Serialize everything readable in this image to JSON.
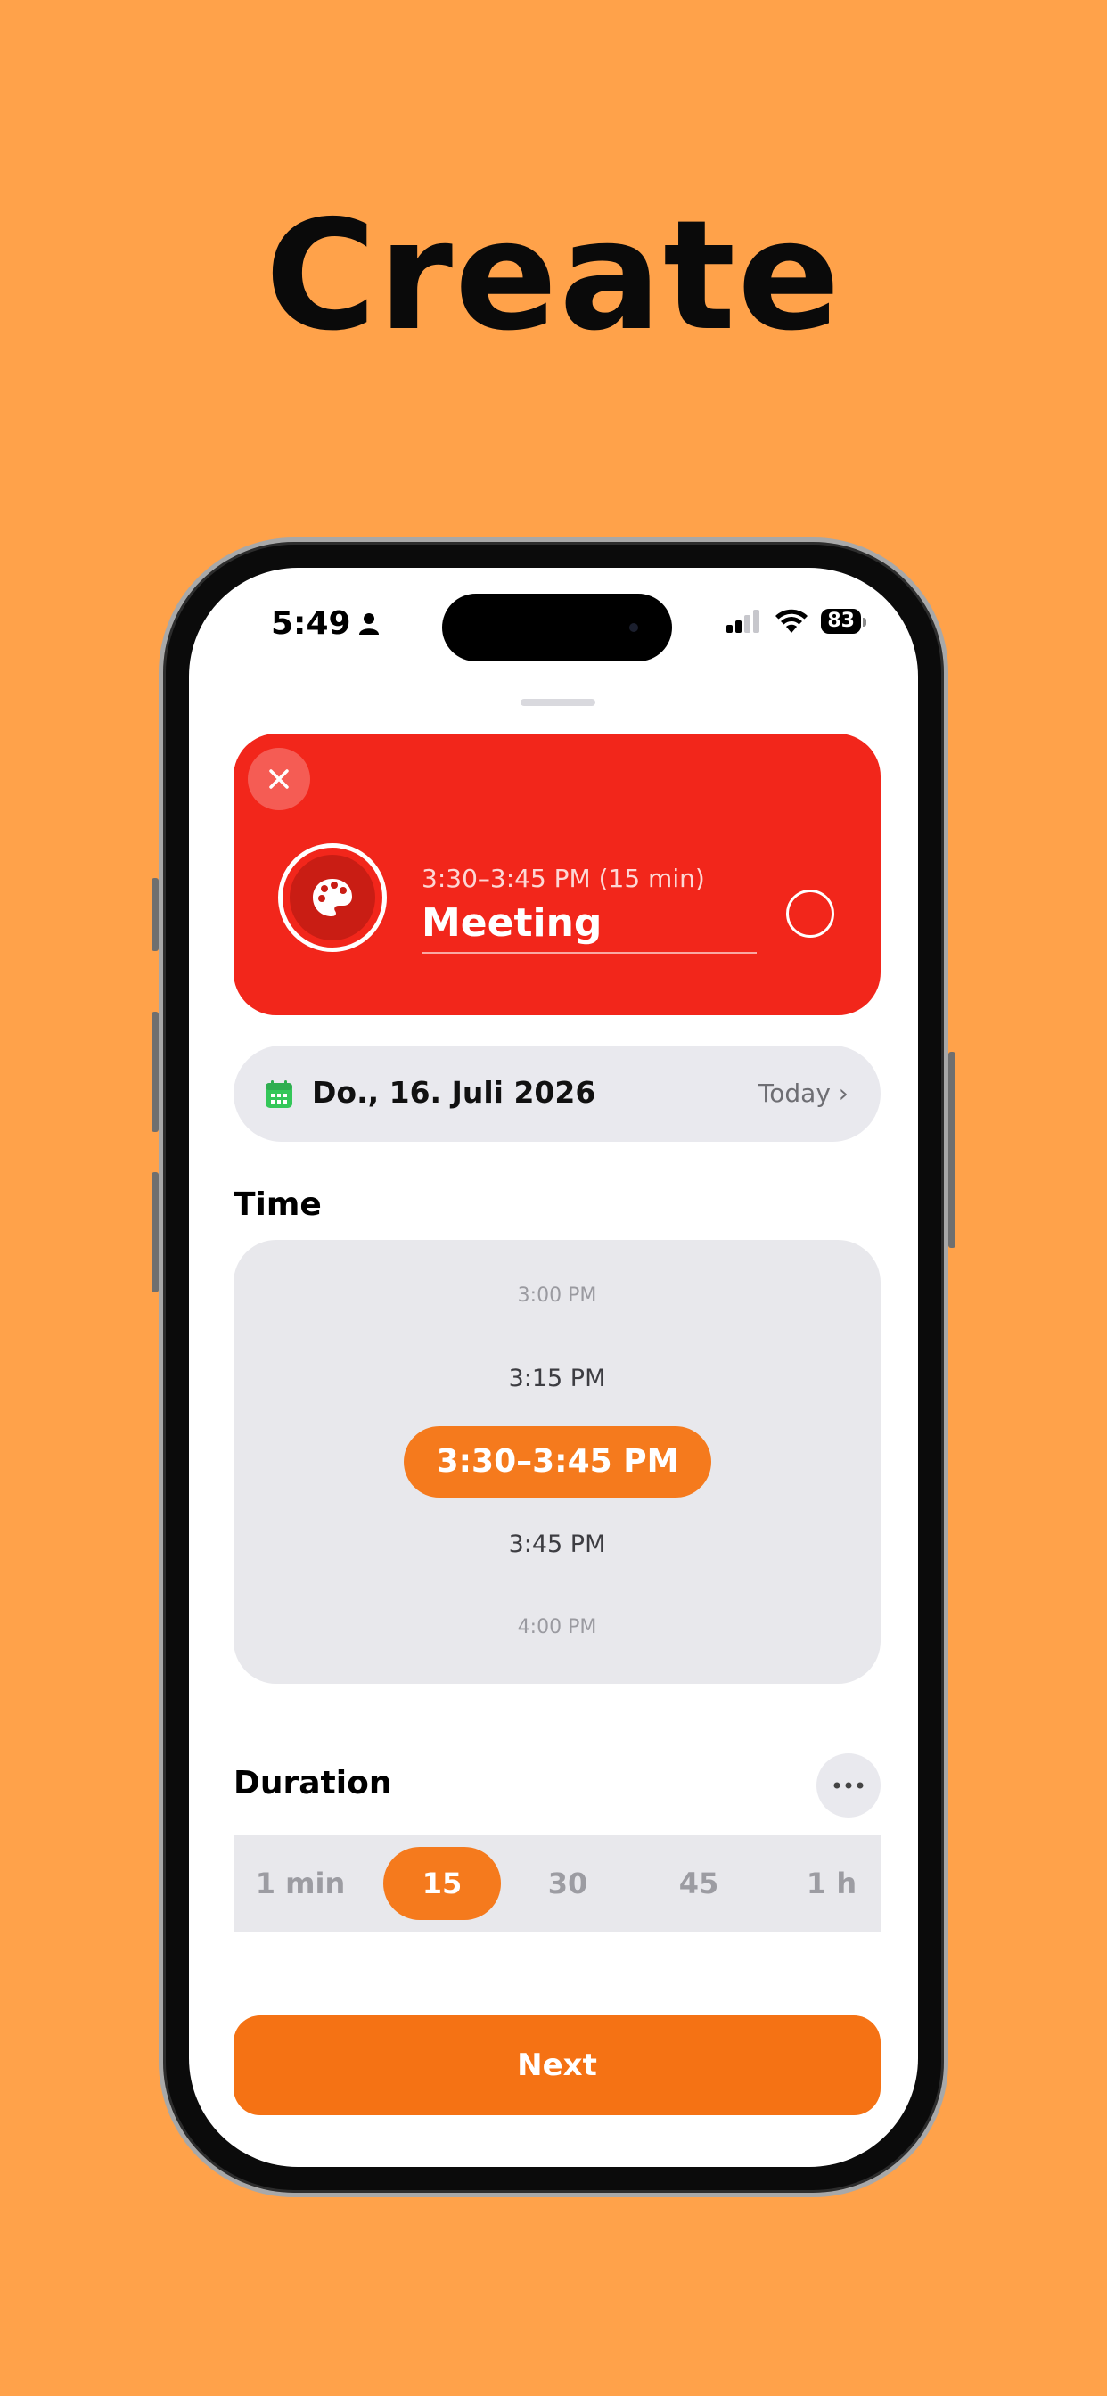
{
  "headline": "Create",
  "status_bar": {
    "time": "5:49",
    "battery": "83"
  },
  "event": {
    "time_range": "3:30–3:45 PM (15 min)",
    "title": "Meeting",
    "color": "#F2261B"
  },
  "date_row": {
    "date": "Do., 16. Juli 2026",
    "today_label": "Today ›"
  },
  "time_section": {
    "title": "Time",
    "options": [
      "3:00 PM",
      "3:15 PM",
      "3:30–3:45 PM",
      "3:45 PM",
      "4:00 PM"
    ],
    "selected": "3:30–3:45 PM"
  },
  "duration_section": {
    "title": "Duration",
    "options": [
      "1 min",
      "15",
      "30",
      "45",
      "1 h"
    ],
    "selected": "15"
  },
  "next_label": "Next",
  "colors": {
    "background": "#FFA24A",
    "accent": "#F57A1D",
    "event_red": "#F2261B"
  },
  "icons": [
    "close-icon",
    "palette-icon",
    "calendar-icon",
    "more-icon",
    "person-icon",
    "signal-icon",
    "wifi-icon"
  ]
}
